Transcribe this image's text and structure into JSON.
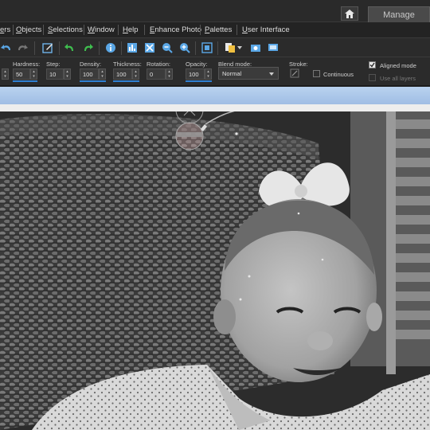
{
  "header": {
    "home_icon": "home-icon",
    "manage_tab": "Manage"
  },
  "menu": {
    "items": [
      "ers",
      "Objects",
      "Selections",
      "Window",
      "Help",
      "Enhance Photo",
      "Palettes",
      "User Interface"
    ]
  },
  "toolbar": {
    "icons": [
      "undo-icon",
      "redo-icon",
      "disabled-redo-icon",
      "edit-icon",
      "rotate-left-icon",
      "rotate-right-icon",
      "info-icon",
      "histogram-icon",
      "fit-icon",
      "zoom-out-icon",
      "zoom-in-icon",
      "view-icon",
      "copy-icon",
      "camera-icon",
      "screen-icon"
    ]
  },
  "tool_options": {
    "hardness": {
      "label": "Hardness:",
      "value": "50"
    },
    "step": {
      "label": "Step:",
      "value": "10"
    },
    "density": {
      "label": "Density:",
      "value": "100"
    },
    "thickness": {
      "label": "Thickness:",
      "value": "100"
    },
    "rotation": {
      "label": "Rotation:",
      "value": "0"
    },
    "opacity": {
      "label": "Opacity:",
      "value": "100"
    },
    "blend_mode": {
      "label": "Blend mode:",
      "value": "Normal"
    },
    "stroke": {
      "label": "Stroke:"
    },
    "continuous": {
      "label": "Continuous",
      "checked": false
    },
    "aligned_mode": {
      "label": "Aligned mode",
      "checked": true
    },
    "use_all_layers": {
      "label": "Use all layers",
      "checked": false
    }
  },
  "colors": {
    "accent_blue": "#2f7fd2",
    "document_titlebar": "#b9d2ef"
  }
}
